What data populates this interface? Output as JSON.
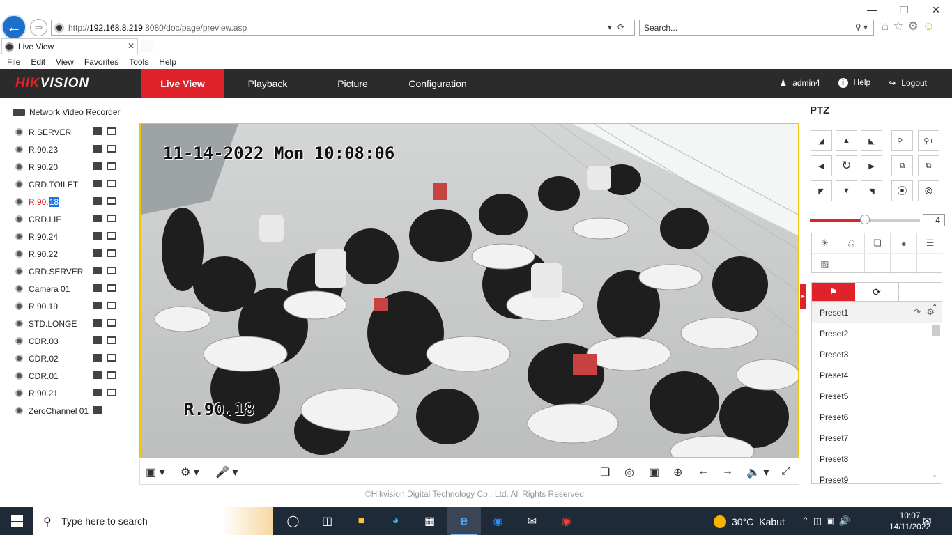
{
  "browser": {
    "address": {
      "protocol": "http://",
      "host": "192.168.8.219",
      "path": ":8080/doc/page/preview.asp"
    },
    "search_placeholder": "Search...",
    "tab_title": "Live View",
    "menu": [
      "File",
      "Edit",
      "View",
      "Favorites",
      "Tools",
      "Help"
    ]
  },
  "app": {
    "brand_red": "HIK",
    "brand_white": "VISION",
    "nav": [
      {
        "label": "Live View",
        "active": true
      },
      {
        "label": "Playback"
      },
      {
        "label": "Picture"
      },
      {
        "label": "Configuration"
      }
    ],
    "user": "admin4",
    "help": "Help",
    "logout": "Logout",
    "accent": "#e0232a"
  },
  "sidebar": {
    "root": "Network Video Recorder",
    "cameras": [
      {
        "name": "R.SERVER"
      },
      {
        "name": "R.90.23"
      },
      {
        "name": "R.90.20"
      },
      {
        "name": "CRD.TOILET"
      },
      {
        "name_a": "R.90.",
        "name_b": "18",
        "active": true
      },
      {
        "name": "CRD.LIF"
      },
      {
        "name": "R.90.24"
      },
      {
        "name": "R.90.22"
      },
      {
        "name": "CRD.SERVER"
      },
      {
        "name": "Camera 01"
      },
      {
        "name": "R.90.19"
      },
      {
        "name": "STD.LONGE"
      },
      {
        "name": "CDR.03"
      },
      {
        "name": "CDR.02"
      },
      {
        "name": "CDR.01"
      },
      {
        "name": "R.90.21"
      },
      {
        "name": "ZeroChannel 01"
      }
    ]
  },
  "video": {
    "timestamp": "11-14-2022 Mon 10:08:06",
    "channel_label": "R.90.18"
  },
  "footer": "©Hikvision Digital Technology Co., Ltd. All Rights Reserved.",
  "ptz": {
    "title": "PTZ",
    "speed": "4",
    "speed_level": 0.5,
    "presets": [
      "Preset1",
      "Preset2",
      "Preset3",
      "Preset4",
      "Preset5",
      "Preset6",
      "Preset7",
      "Preset8",
      "Preset9"
    ]
  },
  "taskbar": {
    "search_placeholder": "Type here to search",
    "temperature": "30°C",
    "weather": "Kabut",
    "time": "10:07",
    "date": "14/11/2022"
  }
}
